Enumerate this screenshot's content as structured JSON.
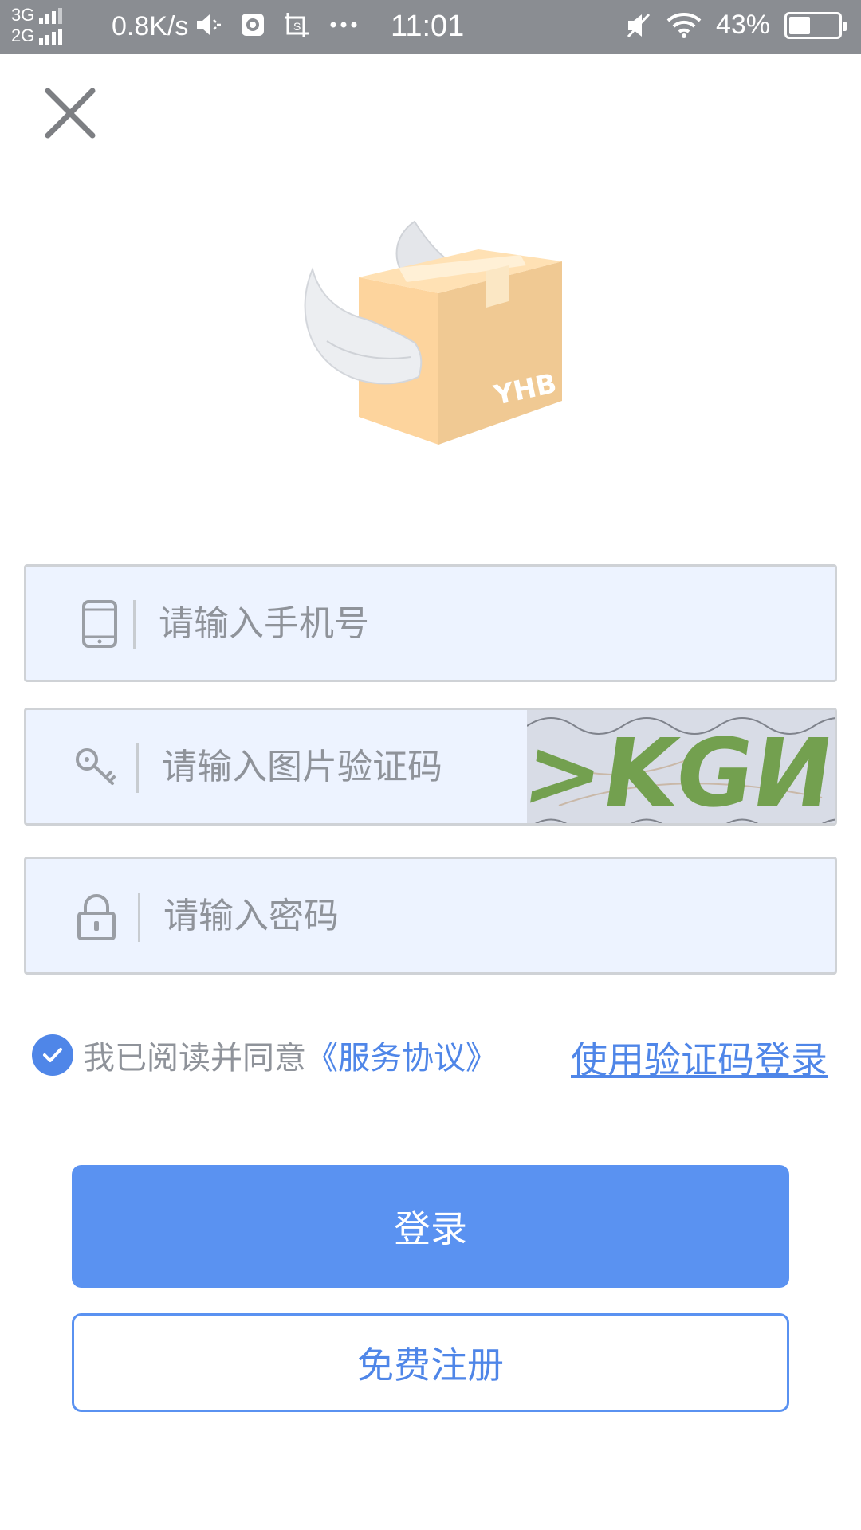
{
  "status_bar": {
    "net_top": "3G",
    "net_bottom": "2G",
    "speed": "0.8K/s",
    "time": "11:01",
    "battery": "43%",
    "icons": [
      "signal-icon",
      "mute-icon",
      "browser-icon",
      "screenshot-icon",
      "more-icon",
      "silent-icon",
      "wifi-icon",
      "battery-icon"
    ]
  },
  "form": {
    "phone_placeholder": "请输入手机号",
    "captcha_placeholder": "请输入图片验证码",
    "captcha_text": ">KGИ",
    "password_placeholder": "请输入密码"
  },
  "logo_text": "YHB",
  "agreement": {
    "text": "我已阅读并同意",
    "link": "《服务协议》",
    "checked": true
  },
  "alt_login_link": "使用验证码登录",
  "buttons": {
    "login": "登录",
    "register": "免费注册"
  },
  "colors": {
    "accent": "#5a92f1",
    "field_bg": "#edf3ff",
    "status_bar": "#8a8d92"
  }
}
